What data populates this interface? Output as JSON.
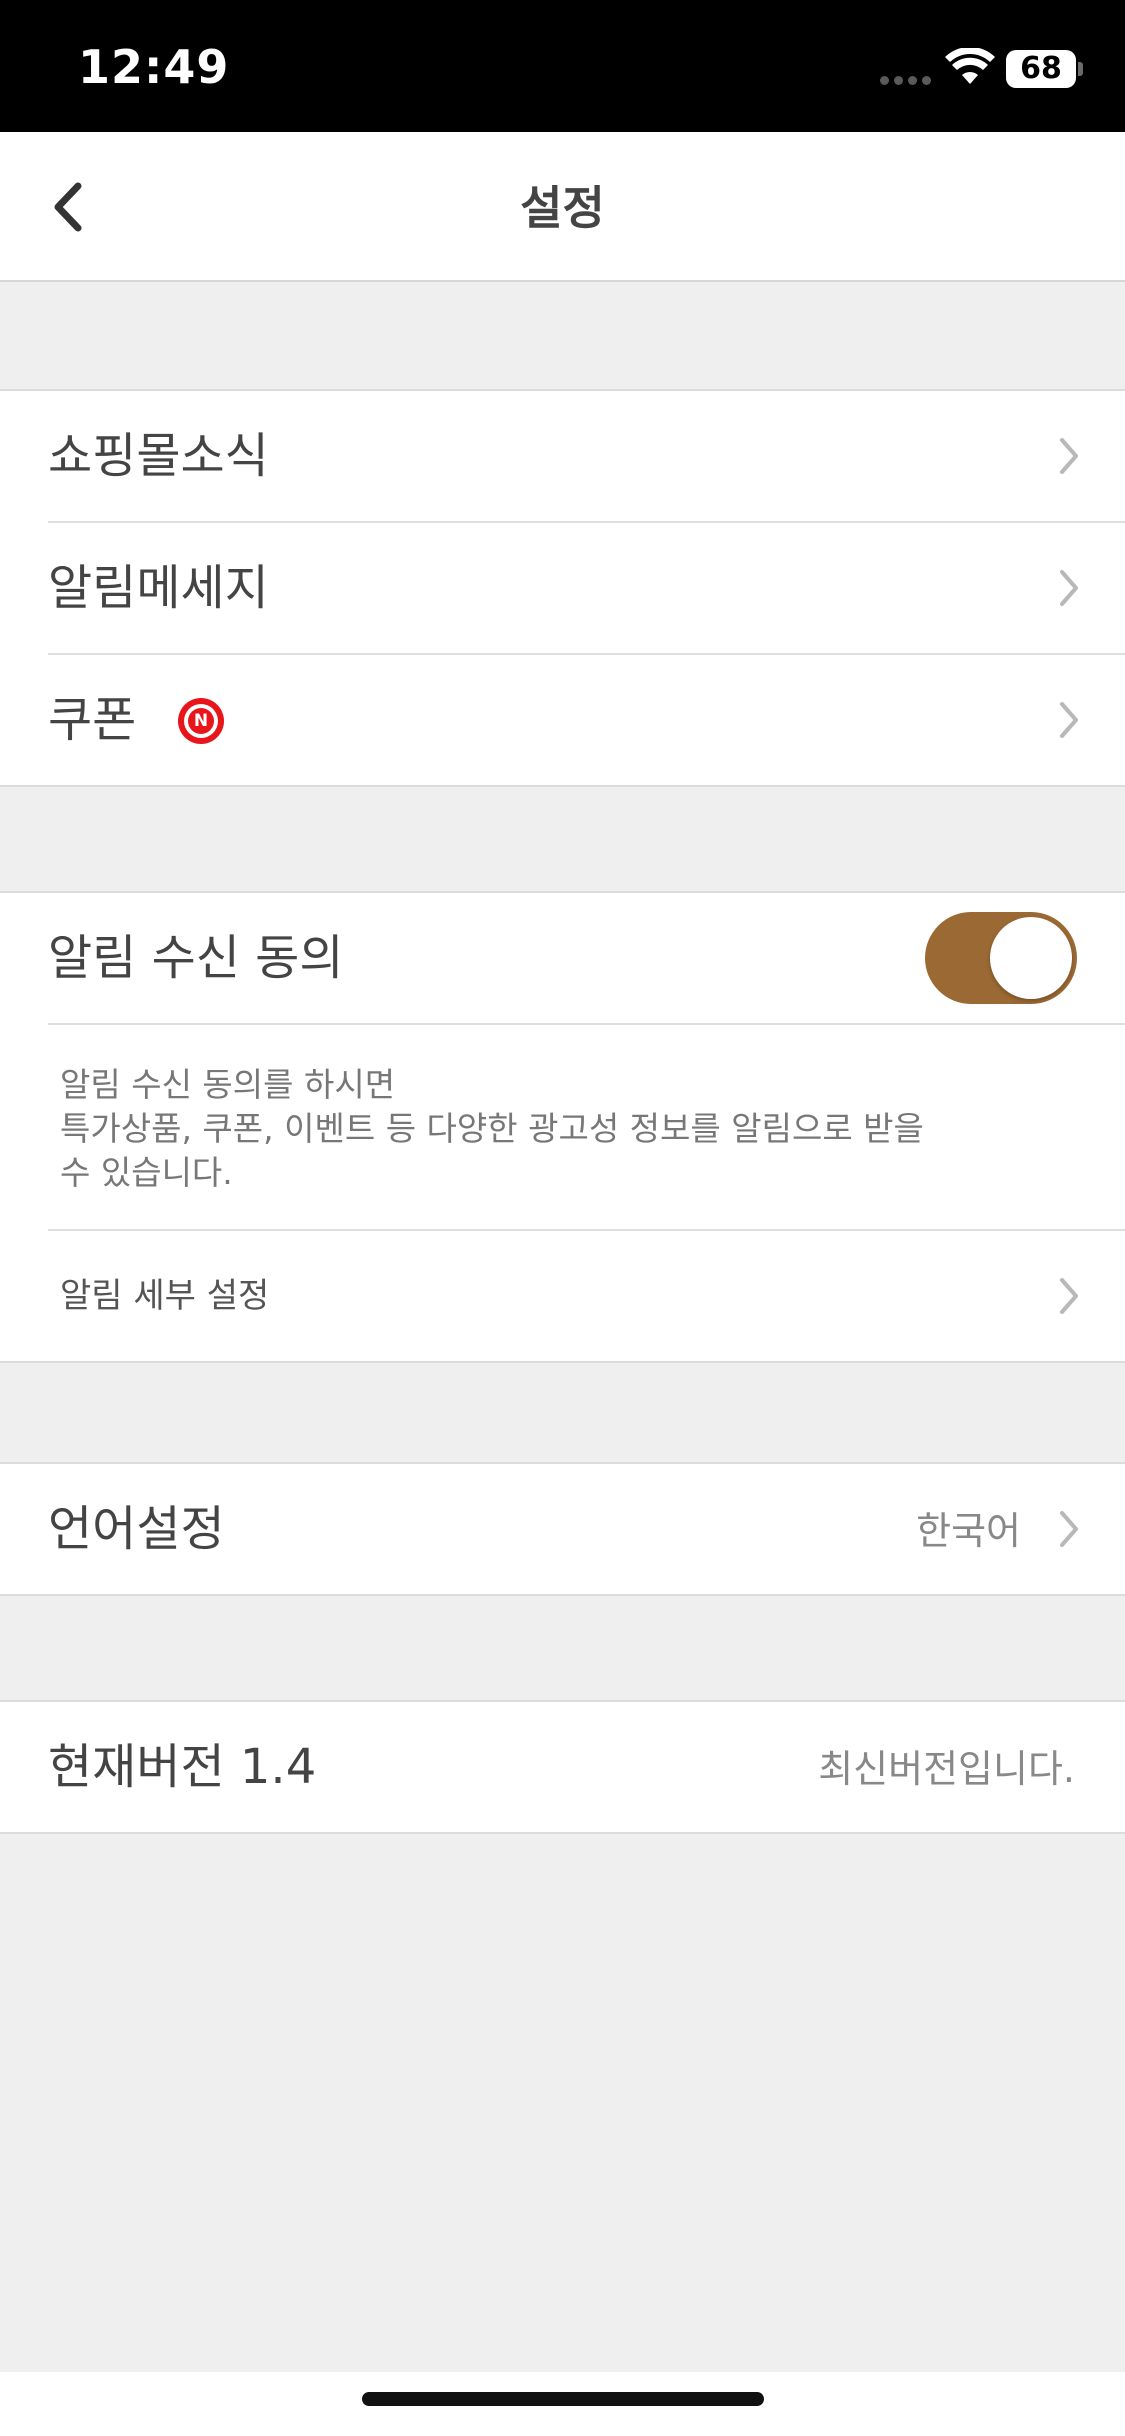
{
  "status_bar": {
    "time": "12:49",
    "battery": "68"
  },
  "nav": {
    "title": "설정",
    "back_icon": "chevron-left-icon"
  },
  "menu_group": {
    "items": [
      {
        "label": "쇼핑몰소식"
      },
      {
        "label": "알림메세지"
      },
      {
        "label": "쿠폰",
        "badge": "N"
      }
    ]
  },
  "notification": {
    "consent_label": "알림 수신 동의",
    "consent_on": true,
    "description_lines": [
      "알림 수신 동의를 하시면",
      "특가상품, 쿠폰, 이벤트 등 다양한 광고성 정보를 알림으로 받을",
      "수 있습니다."
    ],
    "detail_label": "알림 세부 설정"
  },
  "language": {
    "label": "언어설정",
    "value": "한국어"
  },
  "version": {
    "label": "현재버전 1.4",
    "value": "최신버전입니다."
  },
  "colors": {
    "toggle_on": "#9b6934",
    "badge_red": "#e8161b",
    "background": "#efefef"
  }
}
